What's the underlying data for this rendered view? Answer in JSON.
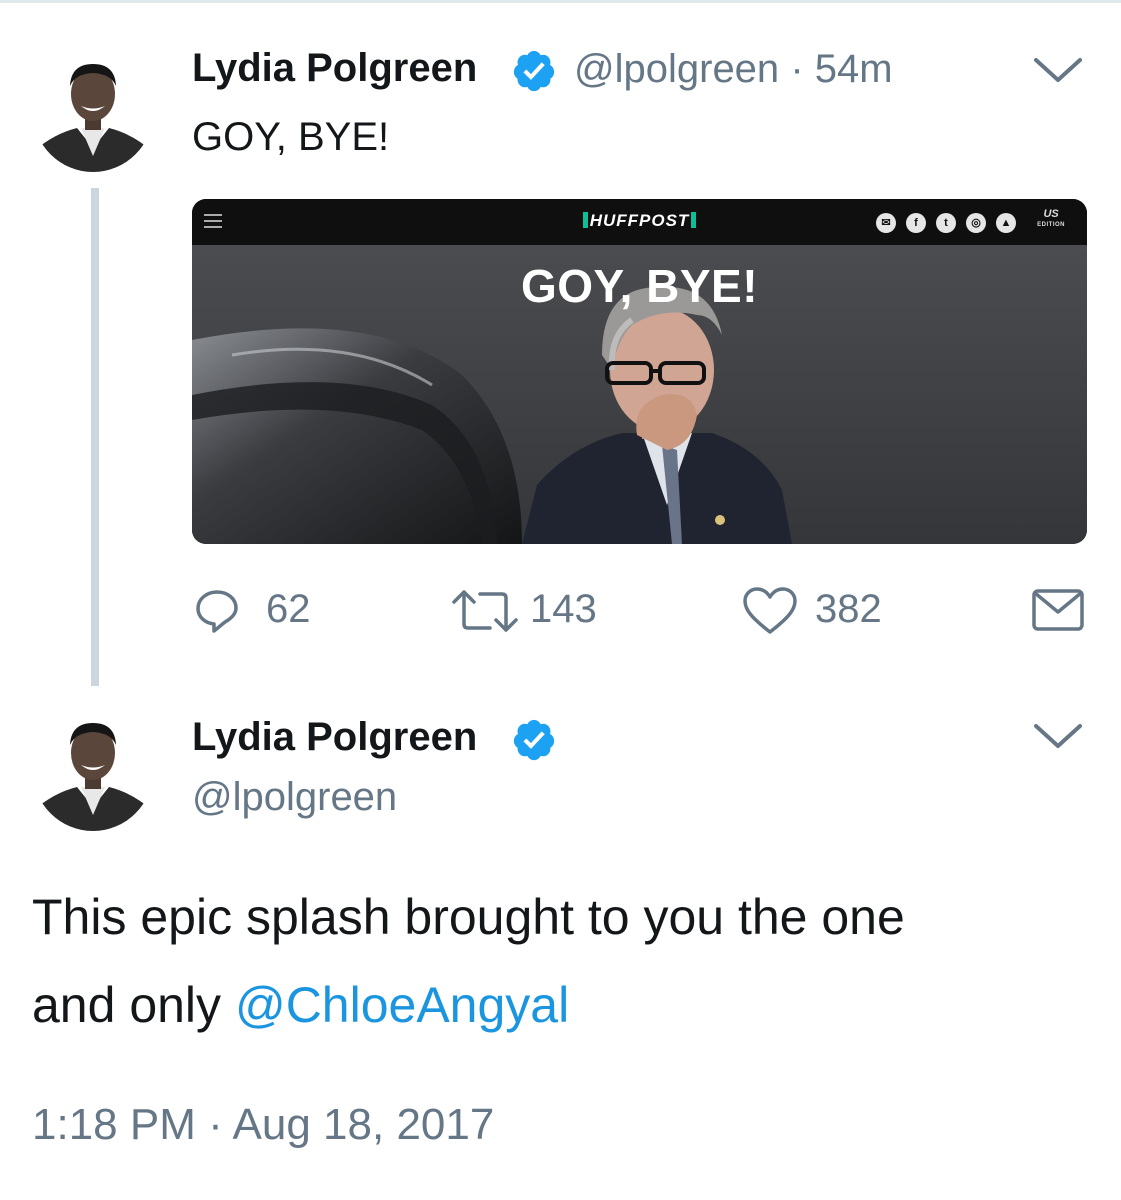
{
  "colors": {
    "link": "#1b95e0",
    "verified": "#1da1f2",
    "meta": "#657786",
    "text": "#14171a",
    "thread_line": "#ccd6dd",
    "huffpost_accent": "#0dbe98"
  },
  "tweet1": {
    "author_name": "Lydia Polgreen",
    "handle": "@lpolgreen",
    "separator": "·",
    "time_ago": "54m",
    "text": "GOY, BYE!",
    "media": {
      "site_logo": "HUFFPOST",
      "headline": "GOY, BYE!",
      "edition_label": "US",
      "edition_sub": "EDITION",
      "social_icons": [
        "mail-icon",
        "facebook-icon",
        "twitter-icon",
        "instagram-icon",
        "snapchat-icon"
      ]
    },
    "actions": {
      "reply_count": "62",
      "retweet_count": "143",
      "like_count": "382"
    }
  },
  "tweet2": {
    "author_name": "Lydia Polgreen",
    "handle": "@lpolgreen",
    "text_line1": "This epic splash brought to you the one",
    "text_line2_prefix": "and only ",
    "mention": "@ChloeAngyal",
    "timestamp": "1:18 PM · Aug 18, 2017"
  }
}
